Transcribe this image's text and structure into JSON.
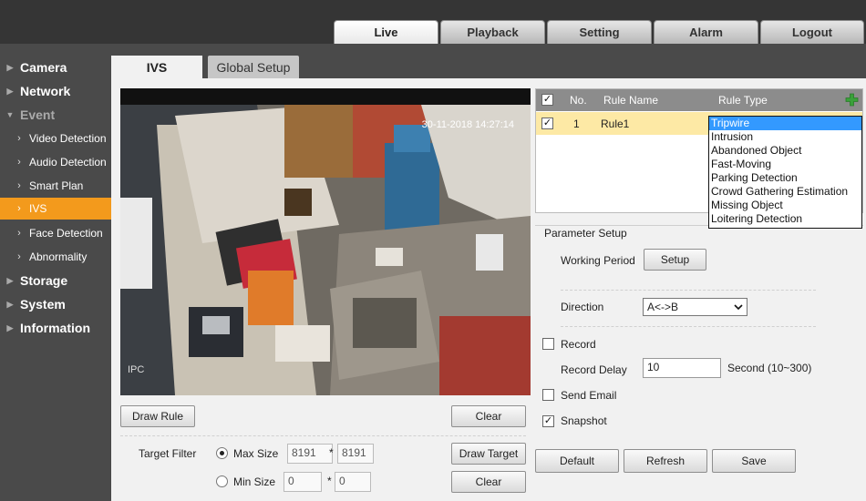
{
  "top_tabs": [
    {
      "label": "Live",
      "active": true
    },
    {
      "label": "Playback",
      "active": false
    },
    {
      "label": "Setting",
      "active": false
    },
    {
      "label": "Alarm",
      "active": false
    },
    {
      "label": "Logout",
      "active": false
    }
  ],
  "sidebar": {
    "camera": "Camera",
    "network": "Network",
    "event": "Event",
    "video_detection": "Video Detection",
    "audio_detection": "Audio Detection",
    "smart_plan": "Smart Plan",
    "ivs": "IVS",
    "face_detection": "Face Detection",
    "abnormality": "Abnormality",
    "storage": "Storage",
    "system": "System",
    "information": "Information"
  },
  "page_tabs": {
    "ivs": "IVS",
    "global": "Global Setup"
  },
  "video": {
    "timestamp": "30-11-2018 14:27:14",
    "overlay": "IPC"
  },
  "left_buttons": {
    "draw_rule": "Draw Rule",
    "clear_top": "Clear",
    "draw_target": "Draw Target",
    "clear_bottom": "Clear"
  },
  "target_filter": {
    "label": "Target Filter",
    "max_label": "Max Size",
    "max_w": "8191",
    "max_h": "8191",
    "min_label": "Min Size",
    "min_w": "0",
    "min_h": "0",
    "sep": "*"
  },
  "rule_table": {
    "headers": {
      "no": "No.",
      "name": "Rule Name",
      "type": "Rule Type"
    },
    "rows": [
      {
        "no": "1",
        "name": "Rule1",
        "checked": true
      }
    ]
  },
  "rule_type_options": [
    "Tripwire",
    "Intrusion",
    "Abandoned Object",
    "Fast-Moving",
    "Parking Detection",
    "Crowd Gathering Estimation",
    "Missing Object",
    "Loitering Detection"
  ],
  "rule_type_selected": "Tripwire",
  "params": {
    "title": "Parameter Setup",
    "working_period": "Working Period",
    "setup_button": "Setup",
    "direction_label": "Direction",
    "direction_value": "A<->B",
    "record": "Record",
    "record_checked": false,
    "record_delay": "Record Delay",
    "record_delay_value": "10",
    "record_delay_unit": "Second (10~300)",
    "send_email": "Send Email",
    "send_email_checked": false,
    "snapshot": "Snapshot",
    "snapshot_checked": true
  },
  "bottom_buttons": {
    "default": "Default",
    "refresh": "Refresh",
    "save": "Save"
  },
  "colors": {
    "accent": "#f39a1c",
    "dropdown_highlight": "#3399ff",
    "row_highlight": "#fde9a5",
    "add_icon": "#3aa13a"
  }
}
